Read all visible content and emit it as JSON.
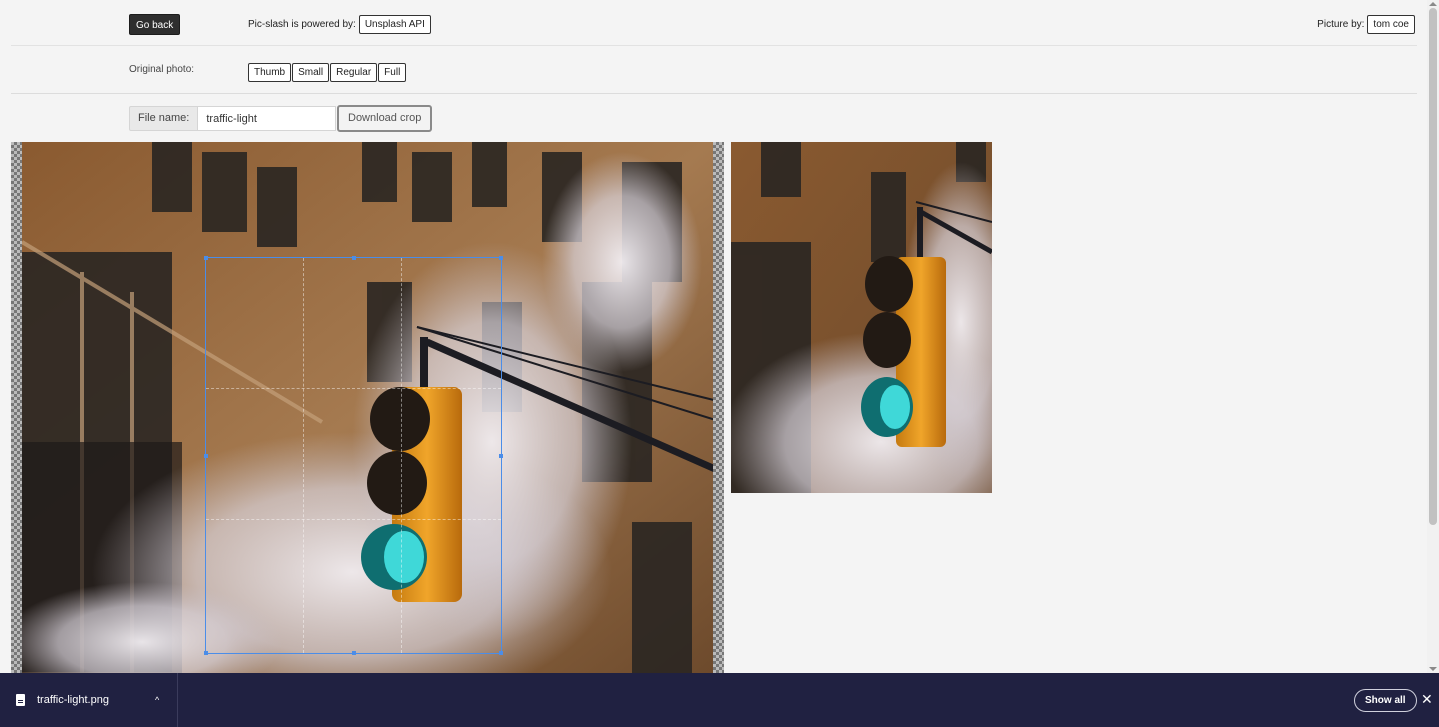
{
  "header": {
    "go_back": "Go back",
    "powered_by": "Pic-slash is powered by:",
    "api_button": "Unsplash API",
    "picture_by": "Picture by:",
    "author": "tom coe"
  },
  "original": {
    "label": "Original photo:",
    "sizes": [
      "Thumb",
      "Small",
      "Regular",
      "Full"
    ]
  },
  "filename": {
    "label": "File name:",
    "value": "traffic-light",
    "download": "Download crop"
  },
  "download_bar": {
    "file_name": "traffic-light.png",
    "show_all": "Show all",
    "close": "✕",
    "caret": "^"
  },
  "colors": {
    "dark_button": "#2e2e2e",
    "crop_border": "#4b8de8",
    "download_bar_bg": "#202141"
  }
}
